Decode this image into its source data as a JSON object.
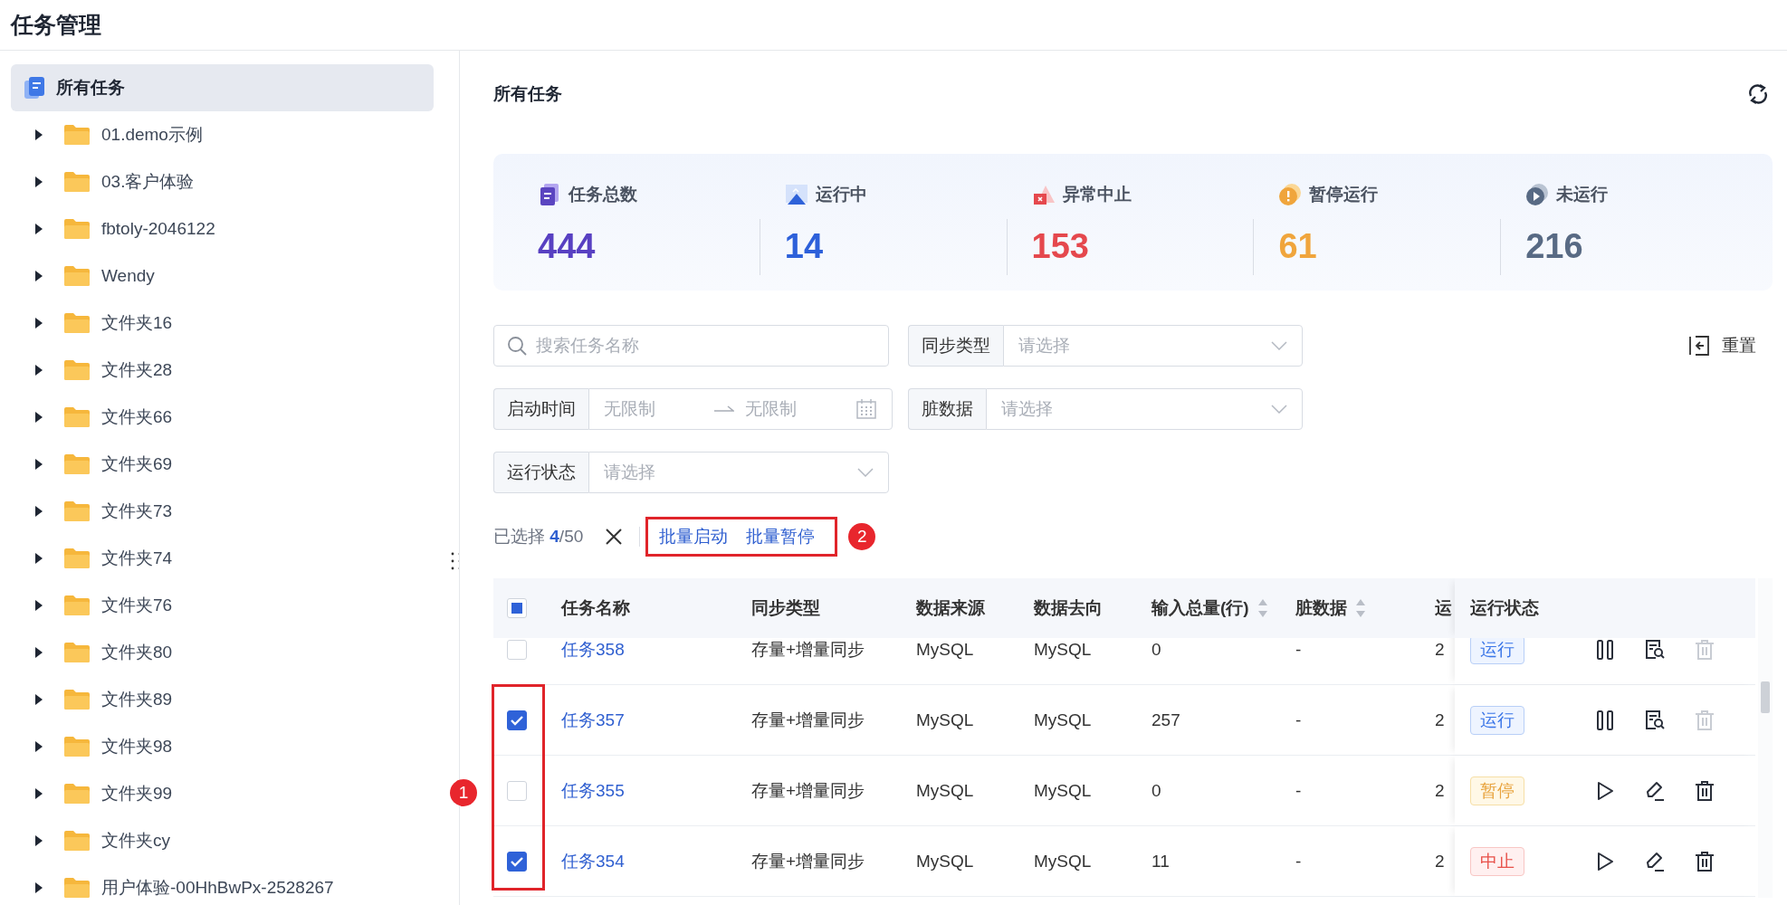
{
  "page_title": "任务管理",
  "sidebar": {
    "root": {
      "label": "所有任务",
      "selected": true
    },
    "folders": [
      {
        "label": "01.demo示例",
        "expanded": false
      },
      {
        "label": "03.客户体验",
        "expanded": false
      },
      {
        "label": "fbtoly-2046122",
        "expanded": false
      },
      {
        "label": "Wendy",
        "expanded": false
      },
      {
        "label": "文件夹16",
        "expanded": false
      },
      {
        "label": "文件夹28",
        "expanded": false
      },
      {
        "label": "文件夹66",
        "expanded": false
      },
      {
        "label": "文件夹69",
        "expanded": false
      },
      {
        "label": "文件夹73",
        "expanded": false
      },
      {
        "label": "文件夹74",
        "expanded": false
      },
      {
        "label": "文件夹76",
        "expanded": false
      },
      {
        "label": "文件夹80",
        "expanded": false
      },
      {
        "label": "文件夹89",
        "expanded": false
      },
      {
        "label": "文件夹98",
        "expanded": false
      },
      {
        "label": "文件夹99",
        "expanded": false
      },
      {
        "label": "文件夹cy",
        "expanded": false
      },
      {
        "label": "用户体验-00HhBwPx-2528267",
        "expanded": false
      }
    ]
  },
  "main": {
    "title": "所有任务",
    "stats": [
      {
        "kind": "total",
        "label": "任务总数",
        "value": "444",
        "color": "#5840c2"
      },
      {
        "kind": "running",
        "label": "运行中",
        "value": "14",
        "color": "#2d60da"
      },
      {
        "kind": "error",
        "label": "异常中止",
        "value": "153",
        "color": "#e5484d"
      },
      {
        "kind": "paused",
        "label": "暂停运行",
        "value": "61",
        "color": "#f0a53c"
      },
      {
        "kind": "idle",
        "label": "未运行",
        "value": "216",
        "color": "#586a84"
      }
    ],
    "filters": {
      "search": {
        "placeholder": "搜索任务名称"
      },
      "sync_type": {
        "label": "同步类型",
        "placeholder": "请选择"
      },
      "start_time": {
        "label": "启动时间",
        "from_placeholder": "无限制",
        "to_placeholder": "无限制"
      },
      "dirty_data": {
        "label": "脏数据",
        "placeholder": "请选择"
      },
      "run_status": {
        "label": "运行状态",
        "placeholder": "请选择"
      },
      "reset_button": "重置"
    },
    "selection_bar": {
      "text": "已选择 **4**/50",
      "actions": [
        "批量启动",
        "批量暂停"
      ],
      "callout": "2"
    },
    "table": {
      "callout": "1",
      "header_checkbox": {
        "indeterminate": true
      },
      "columns": [
        {
          "label": "任务名称",
          "sortable": false
        },
        {
          "label": "同步类型",
          "sortable": false
        },
        {
          "label": "数据来源",
          "sortable": false
        },
        {
          "label": "数据去向",
          "sortable": false
        },
        {
          "label": "输入总量(行)",
          "sortable": true
        },
        {
          "label": "脏数据",
          "sortable": true
        },
        {
          "label": "运"
        },
        {
          "label": "运行状态",
          "sortable": false
        }
      ],
      "rows": [
        {
          "checked": false,
          "name": "任务358",
          "sync_type": "存量+增量同步",
          "source": "MySQL",
          "target": "MySQL",
          "input_total": "0",
          "dirty": "-",
          "column_8": "2",
          "status": {
            "kind": "running",
            "label": "运行"
          },
          "actions": [
            {
              "kind": "pause",
              "disabled": false
            },
            {
              "kind": "view",
              "disabled": false
            },
            {
              "kind": "delete",
              "disabled": true
            }
          ]
        },
        {
          "checked": true,
          "name": "任务357",
          "sync_type": "存量+增量同步",
          "source": "MySQL",
          "target": "MySQL",
          "input_total": "257",
          "dirty": "-",
          "column_8": "2",
          "status": {
            "kind": "running",
            "label": "运行"
          },
          "actions": [
            {
              "kind": "pause",
              "disabled": false
            },
            {
              "kind": "view",
              "disabled": false
            },
            {
              "kind": "delete",
              "disabled": true
            }
          ]
        },
        {
          "checked": false,
          "name": "任务355",
          "sync_type": "存量+增量同步",
          "source": "MySQL",
          "target": "MySQL",
          "input_total": "0",
          "dirty": "-",
          "column_8": "2",
          "status": {
            "kind": "paused",
            "label": "暂停"
          },
          "actions": [
            {
              "kind": "play",
              "disabled": false
            },
            {
              "kind": "edit",
              "disabled": false
            },
            {
              "kind": "delete",
              "disabled": false
            }
          ]
        },
        {
          "checked": true,
          "name": "任务354",
          "sync_type": "存量+增量同步",
          "source": "MySQL",
          "target": "MySQL",
          "input_total": "11",
          "dirty": "-",
          "column_8": "2",
          "status": {
            "kind": "aborted",
            "label": "中止"
          },
          "actions": [
            {
              "kind": "play",
              "disabled": false
            },
            {
              "kind": "edit",
              "disabled": false
            },
            {
              "kind": "delete",
              "disabled": false
            }
          ]
        }
      ]
    }
  }
}
